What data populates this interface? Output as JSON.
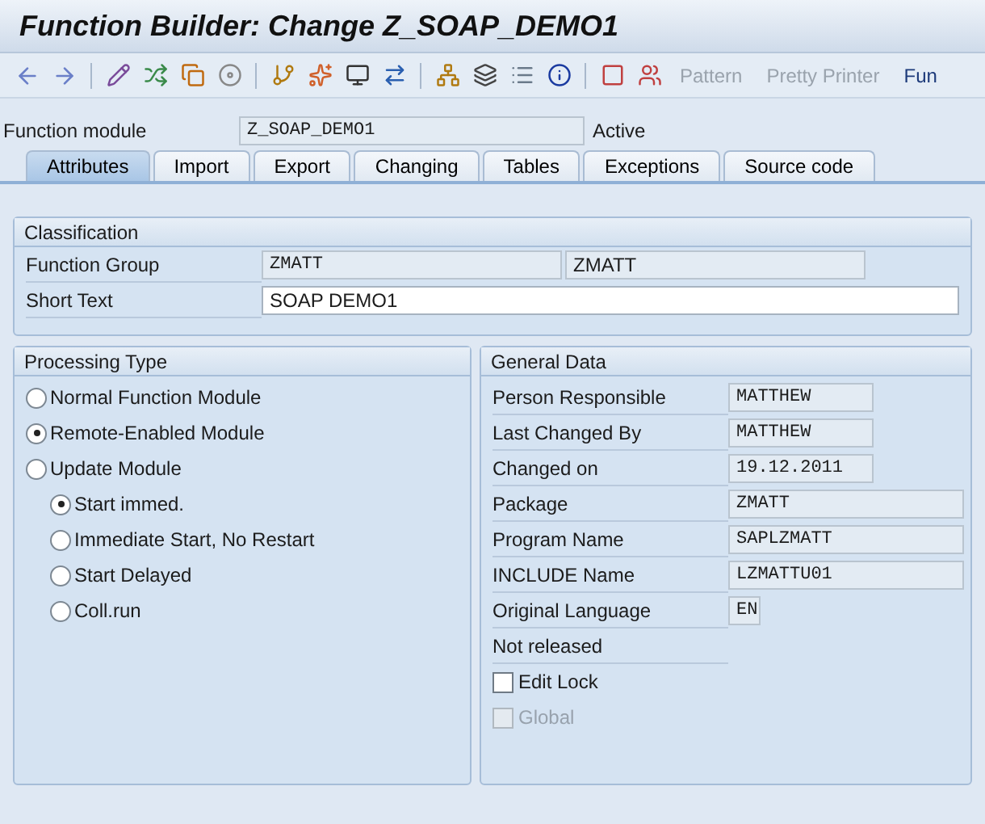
{
  "window": {
    "title": "Function Builder: Change Z_SOAP_DEMO1"
  },
  "toolbar": {
    "buttons": [
      {
        "label": "Pattern",
        "disabled": true
      },
      {
        "label": "Pretty Printer",
        "disabled": true
      },
      {
        "label": "Fun",
        "disabled": false
      }
    ]
  },
  "header": {
    "label": "Function module",
    "value": "Z_SOAP_DEMO1",
    "status": "Active"
  },
  "tabs": [
    {
      "label": "Attributes",
      "selected": true
    },
    {
      "label": "Import",
      "selected": false
    },
    {
      "label": "Export",
      "selected": false
    },
    {
      "label": "Changing",
      "selected": false
    },
    {
      "label": "Tables",
      "selected": false
    },
    {
      "label": "Exceptions",
      "selected": false
    },
    {
      "label": "Source code",
      "selected": false
    }
  ],
  "classification": {
    "title": "Classification",
    "rows": [
      {
        "label": "Function Group",
        "fields": [
          {
            "value": "ZMATT",
            "editable": false
          },
          {
            "value": "ZMATT",
            "editable": false
          }
        ]
      },
      {
        "label": "Short Text",
        "fields": [
          {
            "value": "SOAP DEMO1",
            "editable": true
          }
        ]
      }
    ]
  },
  "processing_type": {
    "title": "Processing Type",
    "options": [
      {
        "label": "Normal Function Module",
        "selected": false
      },
      {
        "label": "Remote-Enabled Module",
        "selected": true
      },
      {
        "label": "Update Module",
        "selected": false,
        "children": [
          {
            "label": "Start immed.",
            "selected": true
          },
          {
            "label": "Immediate Start, No Restart",
            "selected": false
          },
          {
            "label": "Start Delayed",
            "selected": false
          },
          {
            "label": "Coll.run",
            "selected": false
          }
        ]
      }
    ]
  },
  "general_data": {
    "title": "General Data",
    "rows": [
      {
        "label": "Person Responsible",
        "value": "MATTHEW"
      },
      {
        "label": "Last Changed By",
        "value": "MATTHEW"
      },
      {
        "label": "Changed on",
        "value": "19.12.2011"
      },
      {
        "label": "Package",
        "value": "ZMATT"
      },
      {
        "label": "Program Name",
        "value": "SAPLZMATT"
      },
      {
        "label": "INCLUDE Name",
        "value": "LZMATTU01"
      },
      {
        "label": "Original Language",
        "value": "EN"
      }
    ],
    "release_status": "Not released",
    "checkboxes": [
      {
        "label": "Edit Lock",
        "checked": false,
        "disabled": false
      },
      {
        "label": "Global",
        "checked": false,
        "disabled": true
      }
    ]
  }
}
